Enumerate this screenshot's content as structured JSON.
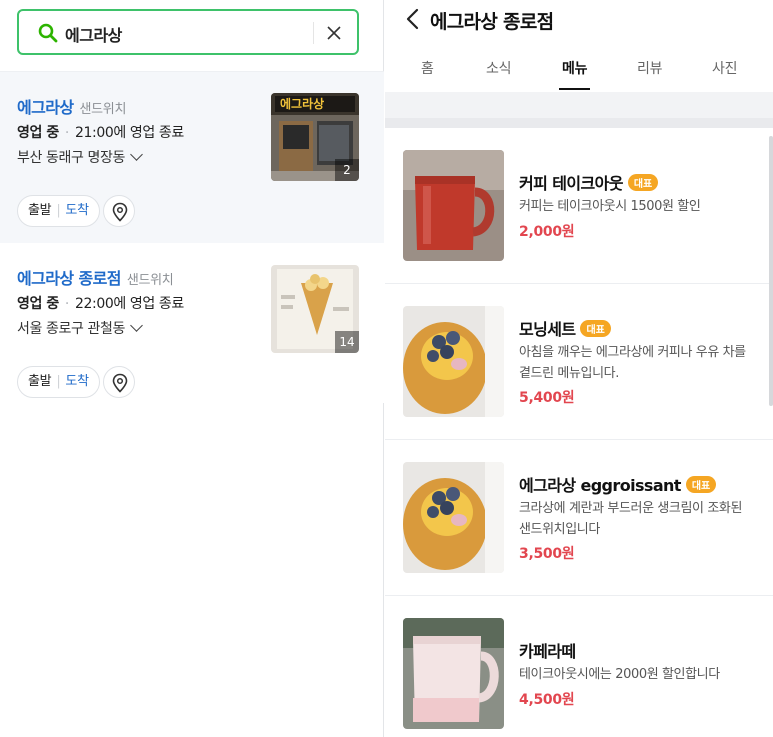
{
  "search": {
    "query": "에그라상"
  },
  "results": [
    {
      "name": "에그라상",
      "category": "샌드위치",
      "status": "영업 중",
      "hours": "21:00에 영업 종료",
      "address": "부산 동래구 명장동",
      "photo_count": "2",
      "thumb_sign": "에그라상",
      "depart_label": "출발",
      "arrive_label": "도착"
    },
    {
      "name": "에그라상 종로점",
      "category": "샌드위치",
      "status": "영업 중",
      "hours": "22:00에 영업 종료",
      "address": "서울 종로구 관철동",
      "photo_count": "14",
      "depart_label": "출발",
      "arrive_label": "도착"
    }
  ],
  "detail": {
    "title": "에그라상 종로점",
    "tabs": [
      "홈",
      "소식",
      "메뉴",
      "리뷰",
      "사진"
    ],
    "active_tab": "메뉴",
    "menu": [
      {
        "name": "커피 테이크아웃",
        "badge": "대표",
        "desc": "커피는 테이크아웃시 1500원 할인",
        "price": "2,000원"
      },
      {
        "name": "모닝세트",
        "badge": "대표",
        "desc": "아침을 깨우는 에그라상에 커피나 우유 차를 곁드린 메뉴입니다.",
        "price": "5,400원"
      },
      {
        "name": "에그라상 eggroissant",
        "badge": "대표",
        "desc": "크라상에 계란과 부드러운 생크림이 조화된 샌드위치입니다",
        "price": "3,500원"
      },
      {
        "name": "카페라떼",
        "badge": "",
        "desc": "테이크아웃시에는 2000원 할인합니다",
        "price": "4,500원"
      }
    ]
  },
  "colors": {
    "accent_blue": "#1f6ac9",
    "search_border": "#3ec26a",
    "price_red": "#e2464f",
    "badge_orange": "#f5a623"
  },
  "icons": [
    "search-icon",
    "close-icon",
    "chevron-down-icon",
    "map-pin-icon",
    "back-arrow-icon"
  ]
}
